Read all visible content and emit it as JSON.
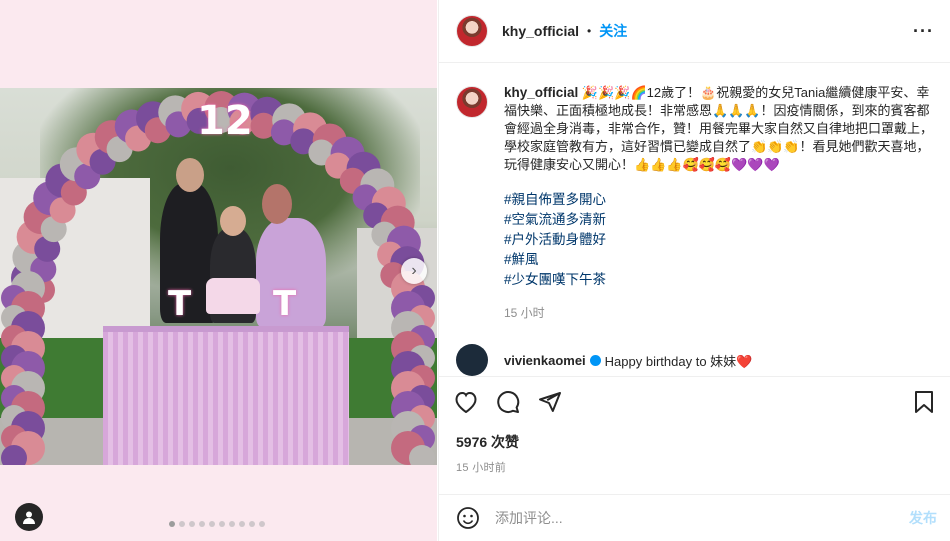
{
  "post": {
    "username": "khy_official",
    "separator": "•",
    "follow_label": "关注",
    "more_label": "···"
  },
  "photo": {
    "balloon_number": "12",
    "marquee_left": "T",
    "marquee_right": "T"
  },
  "caption": {
    "username": "khy_official",
    "text": "🎉🎉🎉🌈12歲了！🎂祝親愛的女兒Tania繼續健康平安、幸福快樂、正面積極地成長！非常感恩🙏🙏🙏！因疫情關係，到來的賓客都會經過全身消毒，非常合作，贊！用餐完畢大家自然又自律地把口罩戴上，學校家庭管教有方，這好習慣已變成自然了👏👏👏！看見她們歡天喜地，玩得健康安心又開心！👍👍👍🥰🥰🥰💜💜💜",
    "hashtags": [
      "#親自佈置多開心",
      "#空氣流通多清新",
      "#户外活動身體好",
      "#鮮風",
      "#少女團嘆下午茶"
    ],
    "time": "15 小时"
  },
  "reply_peek": {
    "username": "vivienkaomei",
    "text": "Happy birthday to 妹妹❤️"
  },
  "stats": {
    "likes": "5976 次赞",
    "posted_ago": "15 小时前"
  },
  "comment_box": {
    "placeholder": "添加评论...",
    "post_label": "发布"
  },
  "carousel": {
    "total": 10,
    "active": 1
  },
  "colors": {
    "accent": "#0095f6",
    "hashtag": "#00376b",
    "muted": "#8e8e8e"
  },
  "icons": [
    "heart-icon",
    "comment-icon",
    "share-icon",
    "bookmark-icon",
    "emoji-icon",
    "more-icon",
    "next-icon",
    "user-tag-icon"
  ]
}
